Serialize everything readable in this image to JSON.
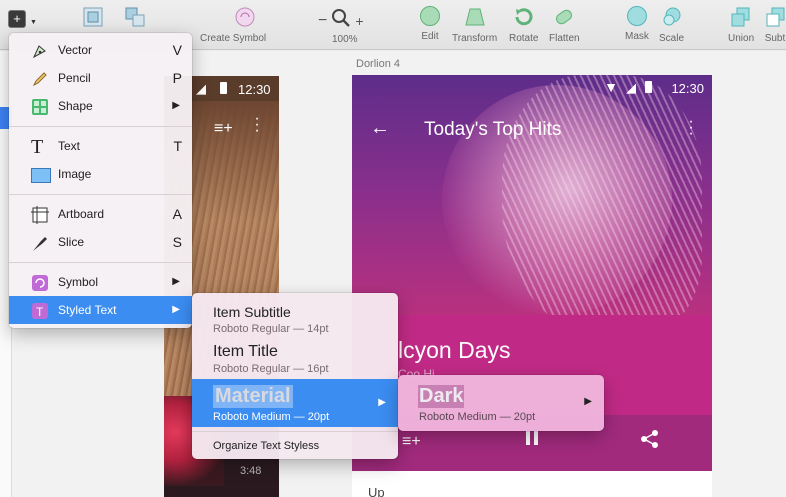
{
  "toolbar": {
    "create_symbol": "Create Symbol",
    "zoom_minus": "−",
    "zoom_plus": "+",
    "zoom_level": "100%",
    "edit": "Edit",
    "transform": "Transform",
    "rotate": "Rotate",
    "flatten": "Flatten",
    "mask": "Mask",
    "scale": "Scale",
    "union": "Union",
    "subtract": "Subt"
  },
  "canvas": {
    "artboard_label": "Dorlion 4",
    "left_phone": {
      "clock": "12:30",
      "time": "3:48"
    },
    "right_phone": {
      "clock": "12:30",
      "title": "Today's Top Hits",
      "song_title": "lcyon Days",
      "song_sub": "Coo Hi...",
      "below_text": "Up"
    }
  },
  "insert_menu": {
    "items": [
      {
        "label": "Vector",
        "key": "V",
        "icon": "pen-icon"
      },
      {
        "label": "Pencil",
        "key": "P",
        "icon": "pencil-icon"
      },
      {
        "label": "Shape",
        "key": "",
        "icon": "shape-icon"
      },
      {
        "label": "Text",
        "key": "T",
        "icon": "text-icon"
      },
      {
        "label": "Image",
        "key": "",
        "icon": "image-icon"
      },
      {
        "label": "Artboard",
        "key": "A",
        "icon": "artboard-icon"
      },
      {
        "label": "Slice",
        "key": "S",
        "icon": "slice-icon"
      },
      {
        "label": "Symbol",
        "key": "",
        "icon": "symbol-icon"
      },
      {
        "label": "Styled Text",
        "key": "",
        "icon": "styled-text-icon"
      }
    ],
    "submenu_arrow": "▶"
  },
  "styled_text_menu": {
    "items": [
      {
        "title": "Item Subtitle",
        "sub": "Roboto Regular — 14pt"
      },
      {
        "title": "Item Title",
        "sub": "Roboto Regular — 16pt"
      },
      {
        "title": "Material",
        "sub": "Roboto Medium — 20pt"
      }
    ],
    "organize": "Organize Text Styless"
  },
  "material_menu": {
    "title": "Dark",
    "sub": "Roboto Medium — 20pt"
  },
  "colors": {
    "accent": "#3b8df2",
    "hero_magenta": "#b8317f"
  }
}
